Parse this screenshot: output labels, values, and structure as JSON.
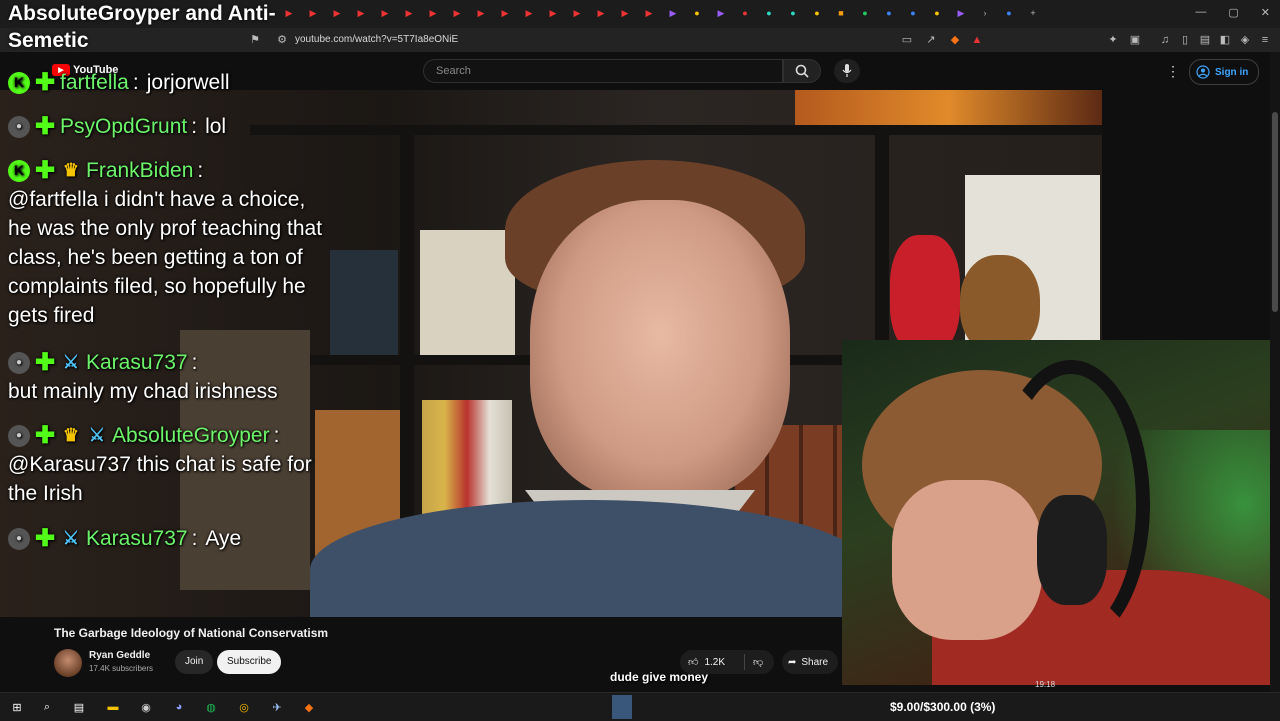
{
  "window": {
    "title": "AbsoluteGroyper and Anti-Semetic",
    "url": "youtube.com/watch?v=5T7Ia8eONiE"
  },
  "youtube": {
    "logo": "YouTube",
    "search_placeholder": "Search",
    "sign_in": "Sign in"
  },
  "chat": [
    {
      "badges": [
        "k",
        "plus"
      ],
      "user": "fartfella",
      "text": "jorjorwell"
    },
    {
      "badges": [
        "avatar",
        "plus"
      ],
      "user": "PsyOpdGrunt",
      "text": "lol"
    },
    {
      "badges": [
        "k",
        "plus",
        "crown"
      ],
      "user": "FrankBiden",
      "text": "@fartfella i didn't have a choice, he was the only prof teaching that class, he's been getting a ton of complaints filed, so hopefully he gets fired"
    },
    {
      "badges": [
        "avatar",
        "plus",
        "sword"
      ],
      "user": "Karasu737",
      "text": "but mainly my chad irishness"
    },
    {
      "badges": [
        "avatar",
        "plus",
        "crown",
        "sword"
      ],
      "user": "AbsoluteGroyper",
      "text": "@Karasu737 this chat is safe for the Irish"
    },
    {
      "badges": [
        "avatar",
        "plus",
        "sword"
      ],
      "user": "Karasu737",
      "text": "Aye"
    }
  ],
  "video": {
    "title": "The Garbage Ideology of National Conservatism",
    "channel": "Ryan Geddle",
    "subscribers": "17.4K subscribers",
    "join": "Join",
    "subscribe": "Subscribe",
    "likes": "1.2K",
    "share": "Share"
  },
  "caption": "dude give money",
  "taskbar": {
    "donation": "$9.00/$300.00 (3%)",
    "clock": "19:18"
  }
}
